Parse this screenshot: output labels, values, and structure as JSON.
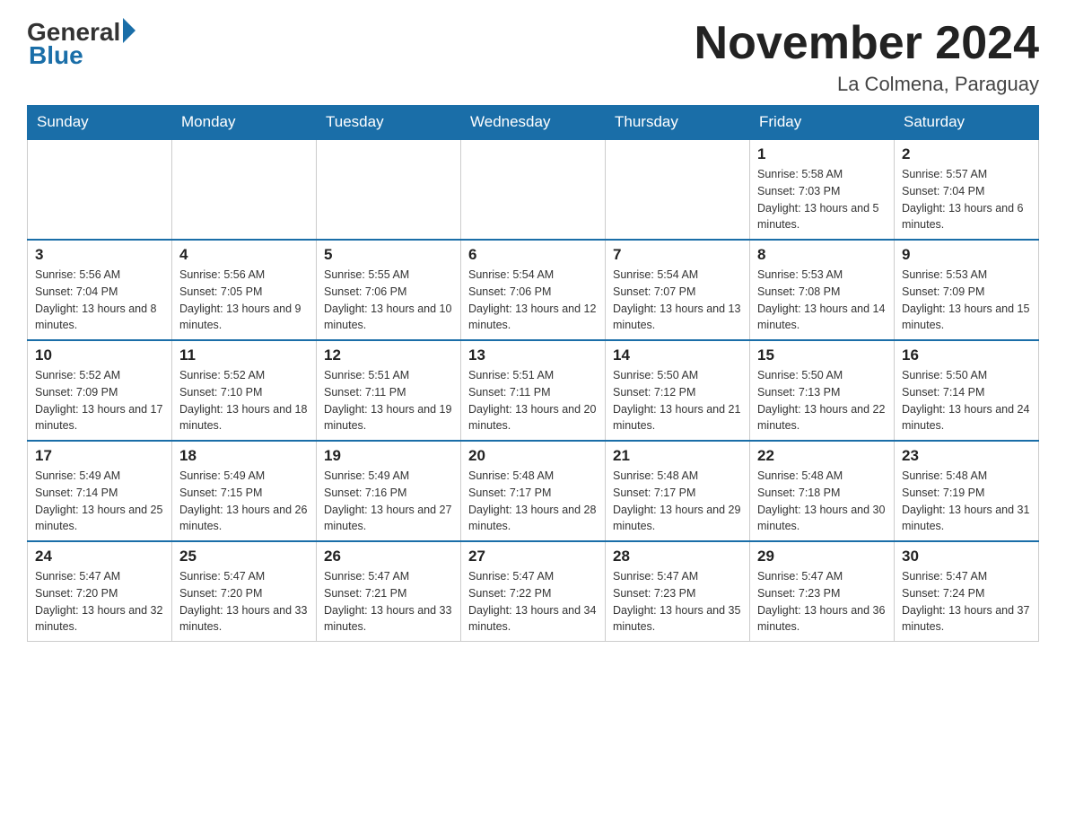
{
  "logo": {
    "general": "General",
    "blue": "Blue"
  },
  "header": {
    "month_year": "November 2024",
    "location": "La Colmena, Paraguay"
  },
  "days_of_week": [
    "Sunday",
    "Monday",
    "Tuesday",
    "Wednesday",
    "Thursday",
    "Friday",
    "Saturday"
  ],
  "weeks": [
    {
      "days": [
        {
          "num": "",
          "info": ""
        },
        {
          "num": "",
          "info": ""
        },
        {
          "num": "",
          "info": ""
        },
        {
          "num": "",
          "info": ""
        },
        {
          "num": "",
          "info": ""
        },
        {
          "num": "1",
          "info": "Sunrise: 5:58 AM\nSunset: 7:03 PM\nDaylight: 13 hours and 5 minutes."
        },
        {
          "num": "2",
          "info": "Sunrise: 5:57 AM\nSunset: 7:04 PM\nDaylight: 13 hours and 6 minutes."
        }
      ]
    },
    {
      "days": [
        {
          "num": "3",
          "info": "Sunrise: 5:56 AM\nSunset: 7:04 PM\nDaylight: 13 hours and 8 minutes."
        },
        {
          "num": "4",
          "info": "Sunrise: 5:56 AM\nSunset: 7:05 PM\nDaylight: 13 hours and 9 minutes."
        },
        {
          "num": "5",
          "info": "Sunrise: 5:55 AM\nSunset: 7:06 PM\nDaylight: 13 hours and 10 minutes."
        },
        {
          "num": "6",
          "info": "Sunrise: 5:54 AM\nSunset: 7:06 PM\nDaylight: 13 hours and 12 minutes."
        },
        {
          "num": "7",
          "info": "Sunrise: 5:54 AM\nSunset: 7:07 PM\nDaylight: 13 hours and 13 minutes."
        },
        {
          "num": "8",
          "info": "Sunrise: 5:53 AM\nSunset: 7:08 PM\nDaylight: 13 hours and 14 minutes."
        },
        {
          "num": "9",
          "info": "Sunrise: 5:53 AM\nSunset: 7:09 PM\nDaylight: 13 hours and 15 minutes."
        }
      ]
    },
    {
      "days": [
        {
          "num": "10",
          "info": "Sunrise: 5:52 AM\nSunset: 7:09 PM\nDaylight: 13 hours and 17 minutes."
        },
        {
          "num": "11",
          "info": "Sunrise: 5:52 AM\nSunset: 7:10 PM\nDaylight: 13 hours and 18 minutes."
        },
        {
          "num": "12",
          "info": "Sunrise: 5:51 AM\nSunset: 7:11 PM\nDaylight: 13 hours and 19 minutes."
        },
        {
          "num": "13",
          "info": "Sunrise: 5:51 AM\nSunset: 7:11 PM\nDaylight: 13 hours and 20 minutes."
        },
        {
          "num": "14",
          "info": "Sunrise: 5:50 AM\nSunset: 7:12 PM\nDaylight: 13 hours and 21 minutes."
        },
        {
          "num": "15",
          "info": "Sunrise: 5:50 AM\nSunset: 7:13 PM\nDaylight: 13 hours and 22 minutes."
        },
        {
          "num": "16",
          "info": "Sunrise: 5:50 AM\nSunset: 7:14 PM\nDaylight: 13 hours and 24 minutes."
        }
      ]
    },
    {
      "days": [
        {
          "num": "17",
          "info": "Sunrise: 5:49 AM\nSunset: 7:14 PM\nDaylight: 13 hours and 25 minutes."
        },
        {
          "num": "18",
          "info": "Sunrise: 5:49 AM\nSunset: 7:15 PM\nDaylight: 13 hours and 26 minutes."
        },
        {
          "num": "19",
          "info": "Sunrise: 5:49 AM\nSunset: 7:16 PM\nDaylight: 13 hours and 27 minutes."
        },
        {
          "num": "20",
          "info": "Sunrise: 5:48 AM\nSunset: 7:17 PM\nDaylight: 13 hours and 28 minutes."
        },
        {
          "num": "21",
          "info": "Sunrise: 5:48 AM\nSunset: 7:17 PM\nDaylight: 13 hours and 29 minutes."
        },
        {
          "num": "22",
          "info": "Sunrise: 5:48 AM\nSunset: 7:18 PM\nDaylight: 13 hours and 30 minutes."
        },
        {
          "num": "23",
          "info": "Sunrise: 5:48 AM\nSunset: 7:19 PM\nDaylight: 13 hours and 31 minutes."
        }
      ]
    },
    {
      "days": [
        {
          "num": "24",
          "info": "Sunrise: 5:47 AM\nSunset: 7:20 PM\nDaylight: 13 hours and 32 minutes."
        },
        {
          "num": "25",
          "info": "Sunrise: 5:47 AM\nSunset: 7:20 PM\nDaylight: 13 hours and 33 minutes."
        },
        {
          "num": "26",
          "info": "Sunrise: 5:47 AM\nSunset: 7:21 PM\nDaylight: 13 hours and 33 minutes."
        },
        {
          "num": "27",
          "info": "Sunrise: 5:47 AM\nSunset: 7:22 PM\nDaylight: 13 hours and 34 minutes."
        },
        {
          "num": "28",
          "info": "Sunrise: 5:47 AM\nSunset: 7:23 PM\nDaylight: 13 hours and 35 minutes."
        },
        {
          "num": "29",
          "info": "Sunrise: 5:47 AM\nSunset: 7:23 PM\nDaylight: 13 hours and 36 minutes."
        },
        {
          "num": "30",
          "info": "Sunrise: 5:47 AM\nSunset: 7:24 PM\nDaylight: 13 hours and 37 minutes."
        }
      ]
    }
  ]
}
